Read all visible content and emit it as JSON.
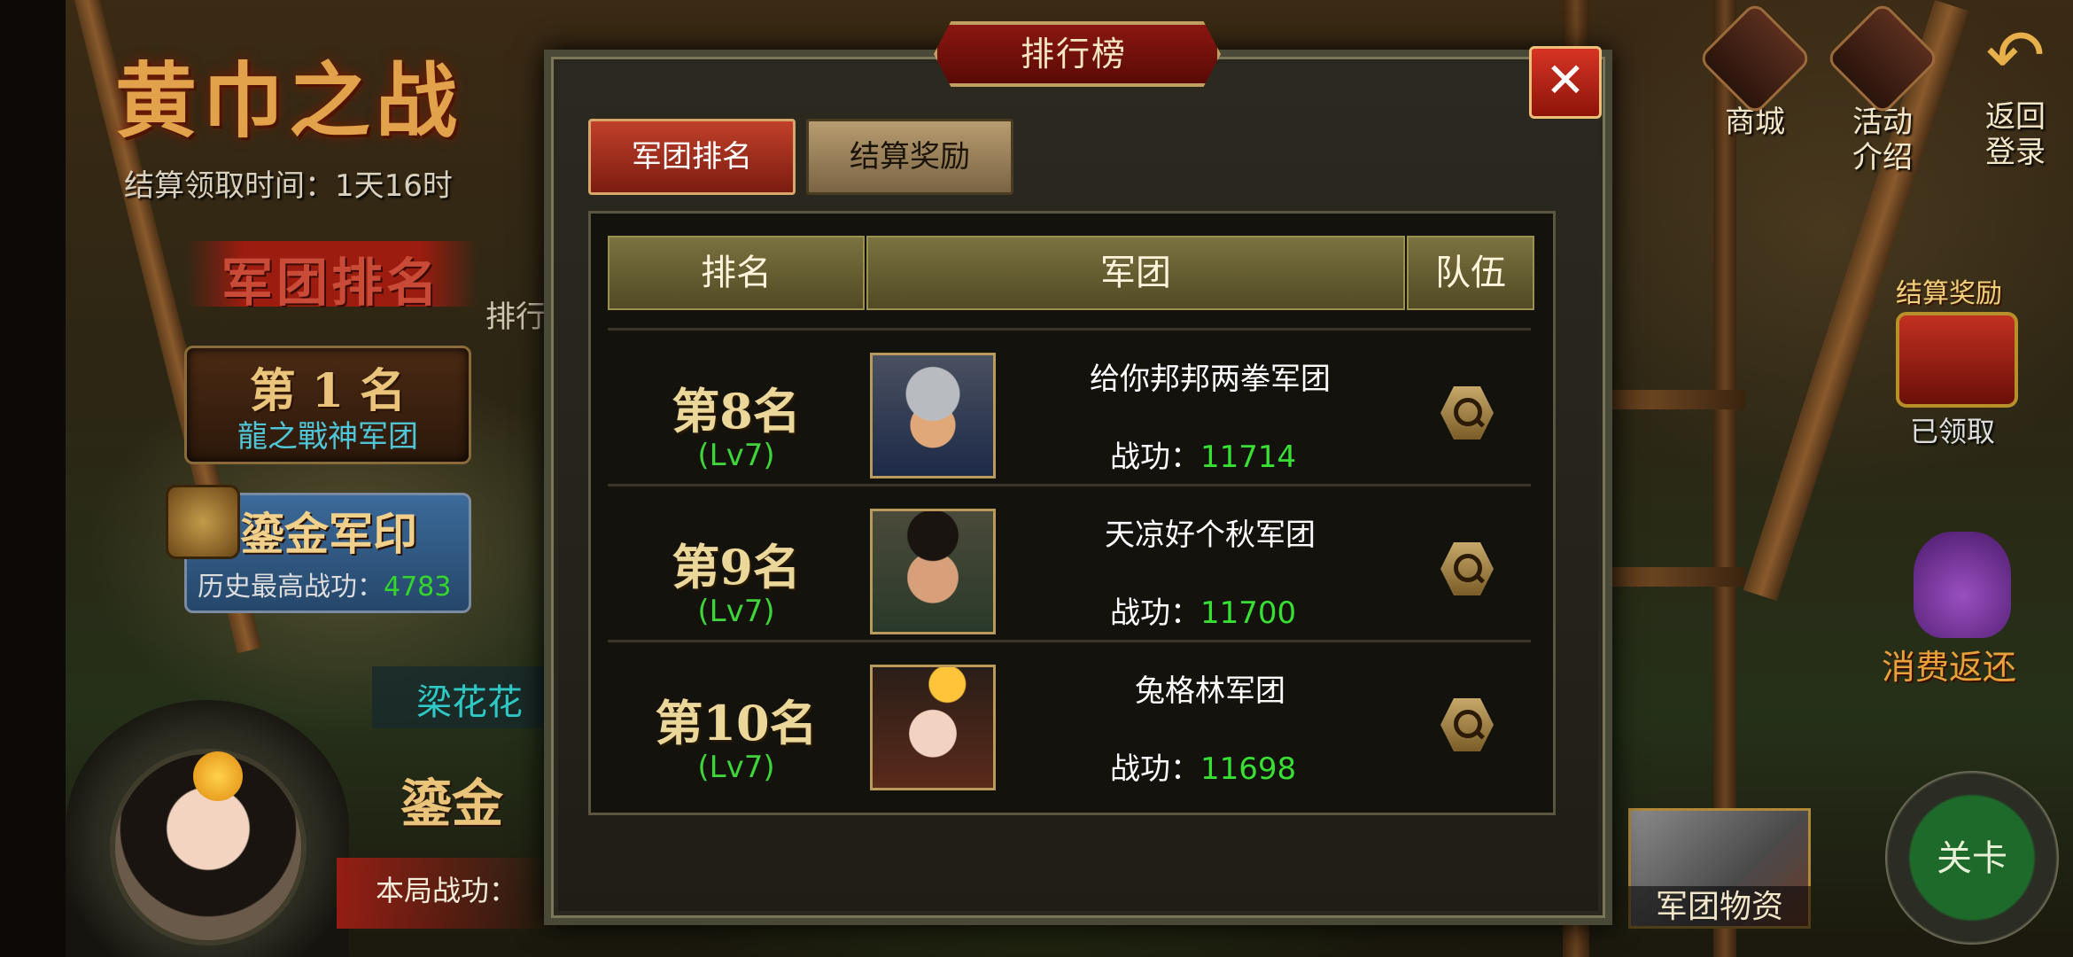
{
  "event": {
    "title": "黄巾之战",
    "settle_time": "结算领取时间：1天16时"
  },
  "left_panel": {
    "legion_rank_heading": "军团排名",
    "side_rank_label": "排行",
    "first_place": "第 1 名",
    "first_legion": "龍之戰神军团",
    "seal_title": "鎏金军印",
    "seal_history_label": "历史最高战功：",
    "seal_history_value": "4783",
    "player_name": "梁花花",
    "seal_sub": "鎏金",
    "round_label": "本局战功："
  },
  "right_panel": {
    "shop_label": "商城",
    "activity_label": "活动\n介绍",
    "back_label": "返回\n登录",
    "reward_label": "结算奖励",
    "reward_status": "已领取",
    "refund_label": "消费返还",
    "supplies_label": "军团物资",
    "stage_label": "关卡"
  },
  "modal": {
    "title": "排行榜",
    "close_glyph": "✕",
    "tabs": [
      {
        "label": "军团排名",
        "active": true
      },
      {
        "label": "结算奖励",
        "active": false
      }
    ],
    "columns": [
      "排名",
      "军团",
      "队伍"
    ],
    "merit_label": "战功：",
    "rows": [
      {
        "rank": "第8名",
        "level": "(Lv7)",
        "legion": "给你邦邦两拳军团",
        "merit": "11714",
        "portrait": "armored-general"
      },
      {
        "rank": "第9名",
        "level": "(Lv7)",
        "legion": "天凉好个秋军团",
        "merit": "11700",
        "portrait": "young-officer"
      },
      {
        "rank": "第10名",
        "level": "(Lv7)",
        "legion": "兔格林军团",
        "merit": "11698",
        "portrait": "lady-with-flower"
      }
    ]
  },
  "colors": {
    "rank_gold": "#ecd79a",
    "level_green": "#3ed43a",
    "merit_green": "#38e034",
    "tab_active": "#c1402a",
    "tab_inactive": "#b89c70",
    "header_olive": "#7a7240"
  }
}
